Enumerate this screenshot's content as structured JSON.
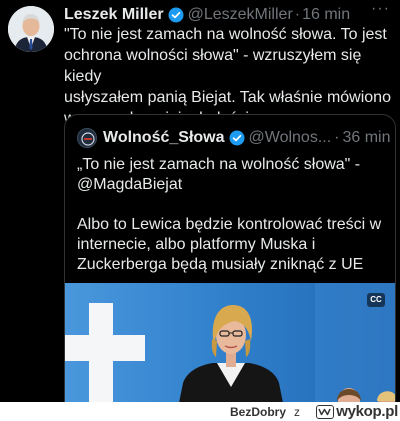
{
  "tweet": {
    "author_name": "Leszek Miller",
    "handle": "@LeszekMiller",
    "separator": "·",
    "time": "16 min",
    "more_icon": "more-dots-icon",
    "text_lines": [
      "\"To nie jest zamach na wolność słowa. To jest",
      "ochrona wolności słowa\" - wzruszyłem się kiedy",
      "usłyszałem panią Biejat. Tak właśnie mówiono",
      "w czasach mojej młodości."
    ]
  },
  "quote": {
    "author_name": "Wolność_Słowa",
    "handle": "@Wolnos...",
    "separator": "·",
    "time": "36 min",
    "text_lines": [
      "„To nie jest zamach na wolność słowa\" -",
      "@MagdaBiejat",
      "",
      "Albo to Lewica będzie kontrolować treści w",
      "internecie, albo platformy Muska i",
      "Zuckerberga będą musiały zniknąć z UE"
    ],
    "media_badge": "CC"
  },
  "footer": {
    "username": "BezDobry",
    "connector": "z",
    "site_name": "wykop.pl"
  },
  "colors": {
    "background": "#000000",
    "text_primary": "#e7e9ea",
    "text_secondary": "#71767b",
    "verified_badge": "#1d9bf0",
    "card_border": "#2f3336",
    "media_blue": "#2a79c4",
    "footer_bg": "#ffffff",
    "footer_text": "#333333"
  }
}
